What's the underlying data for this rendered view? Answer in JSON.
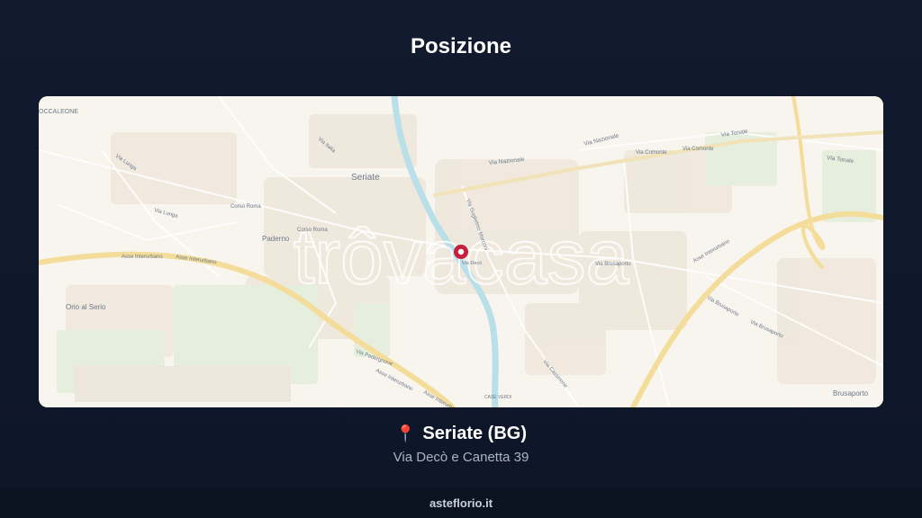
{
  "header": {
    "title": "Posizione"
  },
  "map": {
    "watermark": "trôvacasa",
    "labels": {
      "boccaleone": "OCCALEONE",
      "seriate": "Seriate",
      "paderno": "Paderno",
      "orio": "Orio al Serio",
      "brusaporto": "Brusaporto",
      "via_nazionale_1": "Via Nazionale",
      "via_nazionale_2": "Via Nazionale",
      "via_tonale_1": "Via Tonale",
      "via_tonale_2": "Via Tonale",
      "via_comonte_1": "Via Comonte",
      "via_comonte_2": "Via Comonte",
      "via_italia": "Via Italia",
      "via_lunga_1": "Via Lunga",
      "via_lunga_2": "Via Lunga",
      "corso_roma_1": "Corso Roma",
      "corso_roma_2": "Corso Roma",
      "via_marconi": "Via Guglielmo Marconi",
      "via_brusaporto_1": "Via Brusaporto",
      "via_brusaporto_2": "Via Brusaporto",
      "via_brusaporto_3": "Via Brusaporto",
      "asse_1": "Asse Interurbano",
      "asse_2": "Asse Interurbano",
      "asse_3": "Asse Interurbano",
      "asse_4": "Asse Interurbano",
      "asse_5": "Asse Interurbano",
      "via_cassinone": "Via Cassinone",
      "via_padergnone": "Via Padergnone",
      "via_dei_fiori": "Via Decò",
      "case_verdi": "CASE VERDI"
    },
    "marker_color": "#c8203a"
  },
  "location": {
    "pin_icon": "📍",
    "city": "Seriate (BG)",
    "address": "Via Decò e Canetta 39"
  },
  "footer": {
    "site": "asteflorio.it"
  }
}
